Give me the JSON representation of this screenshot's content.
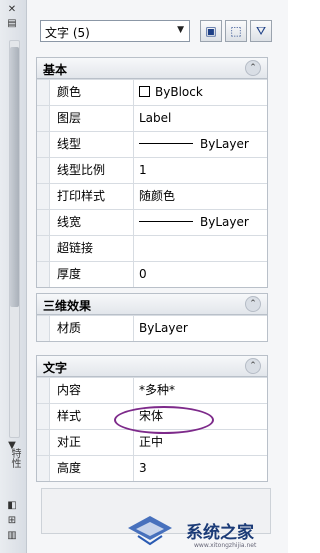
{
  "titlebar": {
    "title": "特性",
    "icon": "properties-icon",
    "buttons": [
      "auto-hide-icon",
      "menu-icon"
    ]
  },
  "toolbar": {
    "select_value": "文字 (5)",
    "icons": [
      "quick-select-icon",
      "select-objects-icon",
      "toggle-pickadd-icon"
    ]
  },
  "sections": [
    {
      "title": "基本",
      "rows": [
        {
          "key": "颜色",
          "value": "ByBlock",
          "kind": "color"
        },
        {
          "key": "图层",
          "value": "Label"
        },
        {
          "key": "线型",
          "value": "ByLayer",
          "kind": "line"
        },
        {
          "key": "线型比例",
          "value": "1"
        },
        {
          "key": "打印样式",
          "value": "随颜色"
        },
        {
          "key": "线宽",
          "value": "ByLayer",
          "kind": "line"
        },
        {
          "key": "超链接",
          "value": ""
        },
        {
          "key": "厚度",
          "value": "0"
        }
      ]
    },
    {
      "title": "三维效果",
      "rows": [
        {
          "key": "材质",
          "value": "ByLayer"
        }
      ]
    },
    {
      "title": "文字",
      "rows": [
        {
          "key": "内容",
          "value": "*多种*"
        },
        {
          "key": "样式",
          "value": "宋体"
        },
        {
          "key": "对正",
          "value": "正中"
        },
        {
          "key": "高度",
          "value": "3"
        }
      ]
    }
  ],
  "watermark": {
    "text": "系统之家",
    "sub": "www.xitongzhijia.net"
  },
  "colors": {
    "accent": "#7d2a8a",
    "header": "#e2e6eb"
  }
}
